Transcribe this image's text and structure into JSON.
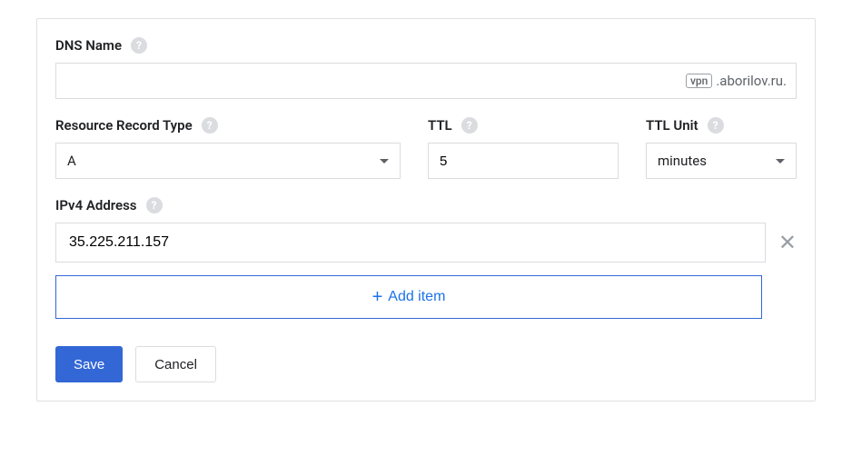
{
  "dnsName": {
    "label": "DNS Name",
    "value": "",
    "badge": "vpn",
    "suffix": ".aborilov.ru."
  },
  "resourceRecordType": {
    "label": "Resource Record Type",
    "value": "A"
  },
  "ttl": {
    "label": "TTL",
    "value": "5"
  },
  "ttlUnit": {
    "label": "TTL Unit",
    "value": "minutes"
  },
  "ipv4": {
    "label": "IPv4 Address",
    "addresses": [
      "35.225.211.157"
    ]
  },
  "addItem": {
    "label": "Add item"
  },
  "buttons": {
    "save": "Save",
    "cancel": "Cancel"
  }
}
